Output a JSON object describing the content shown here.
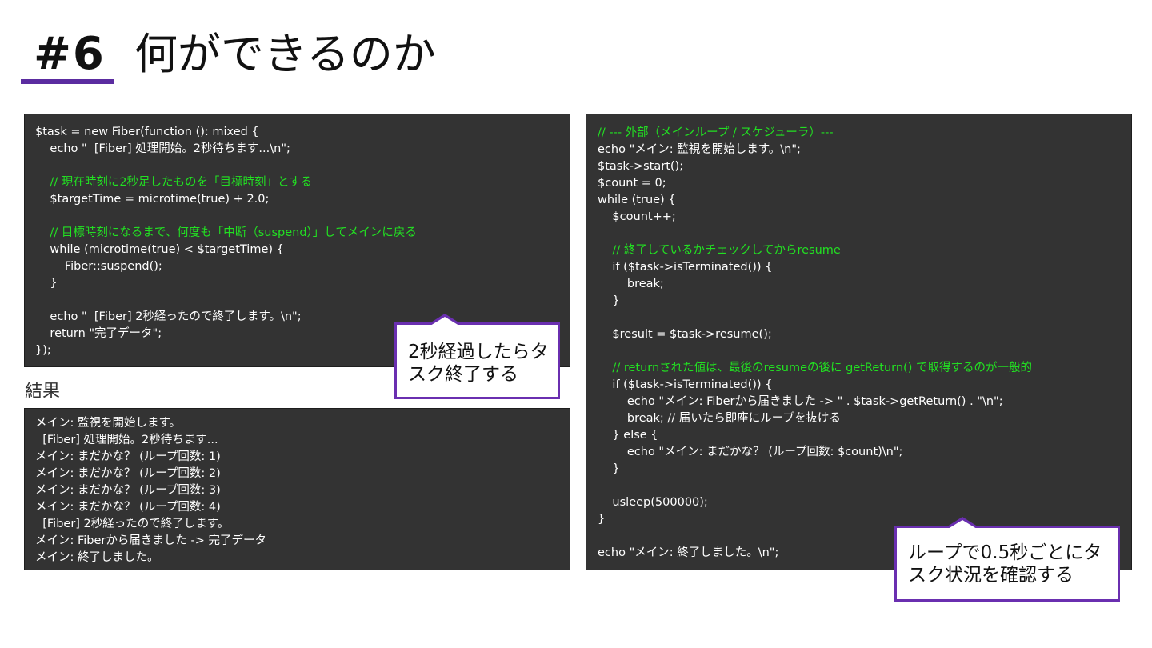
{
  "slide": {
    "number": "#6",
    "title": "何ができるのか",
    "accent_color": "#5b2ca0"
  },
  "code_left": [
    {
      "text": "$task = new Fiber(function (): mixed {",
      "type": "code"
    },
    {
      "text": "    echo \"  [Fiber] 処理開始。2秒待ちます...\\n\";",
      "type": "code"
    },
    {
      "text": "",
      "type": "code"
    },
    {
      "text": "    // 現在時刻に2秒足したものを「目標時刻」とする",
      "type": "comment"
    },
    {
      "text": "    $targetTime = microtime(true) + 2.0;",
      "type": "code"
    },
    {
      "text": "",
      "type": "code"
    },
    {
      "text": "    // 目標時刻になるまで、何度も「中断（suspend）」してメインに戻る",
      "type": "comment"
    },
    {
      "text": "    while (microtime(true) < $targetTime) {",
      "type": "code"
    },
    {
      "text": "        Fiber::suspend();",
      "type": "code"
    },
    {
      "text": "    }",
      "type": "code"
    },
    {
      "text": "",
      "type": "code"
    },
    {
      "text": "    echo \"  [Fiber] 2秒経ったので終了します。\\n\";",
      "type": "code"
    },
    {
      "text": "    return \"完了データ\";",
      "type": "code"
    },
    {
      "text": "});",
      "type": "code"
    }
  ],
  "result": {
    "label": "結果",
    "lines": [
      "メイン: 監視を開始します。",
      "  [Fiber] 処理開始。2秒待ちます...",
      "メイン: まだかな？ (ループ回数: 1)",
      "メイン: まだかな？ (ループ回数: 2)",
      "メイン: まだかな？ (ループ回数: 3)",
      "メイン: まだかな？ (ループ回数: 4)",
      "  [Fiber] 2秒経ったので終了します。",
      "メイン: Fiberから届きました -> 完了データ",
      "メイン: 終了しました。"
    ]
  },
  "code_right": [
    {
      "text": "// --- 外部（メインループ / スケジューラ）---",
      "type": "comment"
    },
    {
      "text": "echo \"メイン: 監視を開始します。\\n\";",
      "type": "code"
    },
    {
      "text": "$task->start();",
      "type": "code"
    },
    {
      "text": "$count = 0;",
      "type": "code"
    },
    {
      "text": "while (true) {",
      "type": "code"
    },
    {
      "text": "    $count++;",
      "type": "code"
    },
    {
      "text": "",
      "type": "code"
    },
    {
      "text": "    // 終了しているかチェックしてからresume",
      "type": "comment"
    },
    {
      "text": "    if ($task->isTerminated()) {",
      "type": "code"
    },
    {
      "text": "        break;",
      "type": "code"
    },
    {
      "text": "    }",
      "type": "code"
    },
    {
      "text": "",
      "type": "code"
    },
    {
      "text": "    $result = $task->resume();",
      "type": "code"
    },
    {
      "text": "",
      "type": "code"
    },
    {
      "text": "    // returnされた値は、最後のresumeの後に getReturn() で取得するのが一般的",
      "type": "comment"
    },
    {
      "text": "    if ($task->isTerminated()) {",
      "type": "code"
    },
    {
      "text": "        echo \"メイン: Fiberから届きました -> \" . $task->getReturn() . \"\\n\";",
      "type": "code"
    },
    {
      "text": "        break; // 届いたら即座にループを抜ける",
      "type": "code"
    },
    {
      "text": "    } else {",
      "type": "code"
    },
    {
      "text": "        echo \"メイン: まだかな？ (ループ回数: $count)\\n\";",
      "type": "code"
    },
    {
      "text": "    }",
      "type": "code"
    },
    {
      "text": "",
      "type": "code"
    },
    {
      "text": "    usleep(500000);",
      "type": "code"
    },
    {
      "text": "}",
      "type": "code"
    },
    {
      "text": "",
      "type": "code"
    },
    {
      "text": "echo \"メイン: 終了しました。\\n\";",
      "type": "code"
    }
  ],
  "callouts": {
    "left": [
      "2秒経過したらタ",
      "スク終了する"
    ],
    "right": [
      "ループで0.5秒ごとにタ",
      "スク状況を確認する"
    ]
  },
  "colors": {
    "code_background": "#333333",
    "code_text": "#ffffff",
    "comment_text": "#22e022",
    "callout_border": "#6a2fb0"
  }
}
